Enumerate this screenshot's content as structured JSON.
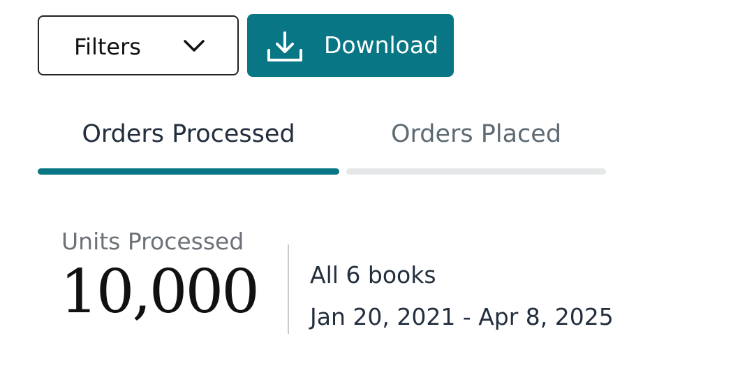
{
  "toolbar": {
    "filters_label": "Filters",
    "download_label": "Download",
    "accent_color": "#087684"
  },
  "tabs": [
    {
      "label": "Orders Processed",
      "active": true
    },
    {
      "label": "Orders Placed",
      "active": false
    }
  ],
  "summary": {
    "units_label": "Units Processed",
    "units_value": "10,000",
    "books": "All 6 books",
    "date_range": "Jan 20, 2021 - Apr 8, 2025"
  },
  "icons": {
    "filters_dropdown": "chevron-down-icon",
    "download": "download-icon"
  }
}
